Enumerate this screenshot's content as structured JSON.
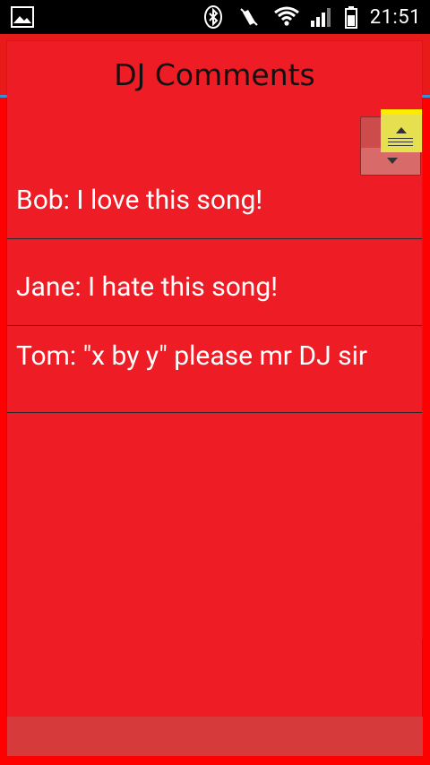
{
  "status_bar": {
    "time": "21:51",
    "icons": [
      "image-icon",
      "bluetooth-icon",
      "vibrate-off-icon",
      "wifi-icon",
      "signal-icon",
      "battery-icon"
    ]
  },
  "dialog": {
    "title": "DJ Comments",
    "comments": [
      {
        "text": "Bob: I love this song!"
      },
      {
        "text": "Jane: I hate this song!"
      },
      {
        "text": "Tom:  \"x by y\" please mr DJ sir"
      }
    ]
  },
  "colors": {
    "background": "#ff0000",
    "dialog": "#ee1c25",
    "statusbar": "#000000",
    "divider": "#2a2a2a",
    "blue_line": "#3b8fd2",
    "note_yellow": "#e6e050"
  }
}
